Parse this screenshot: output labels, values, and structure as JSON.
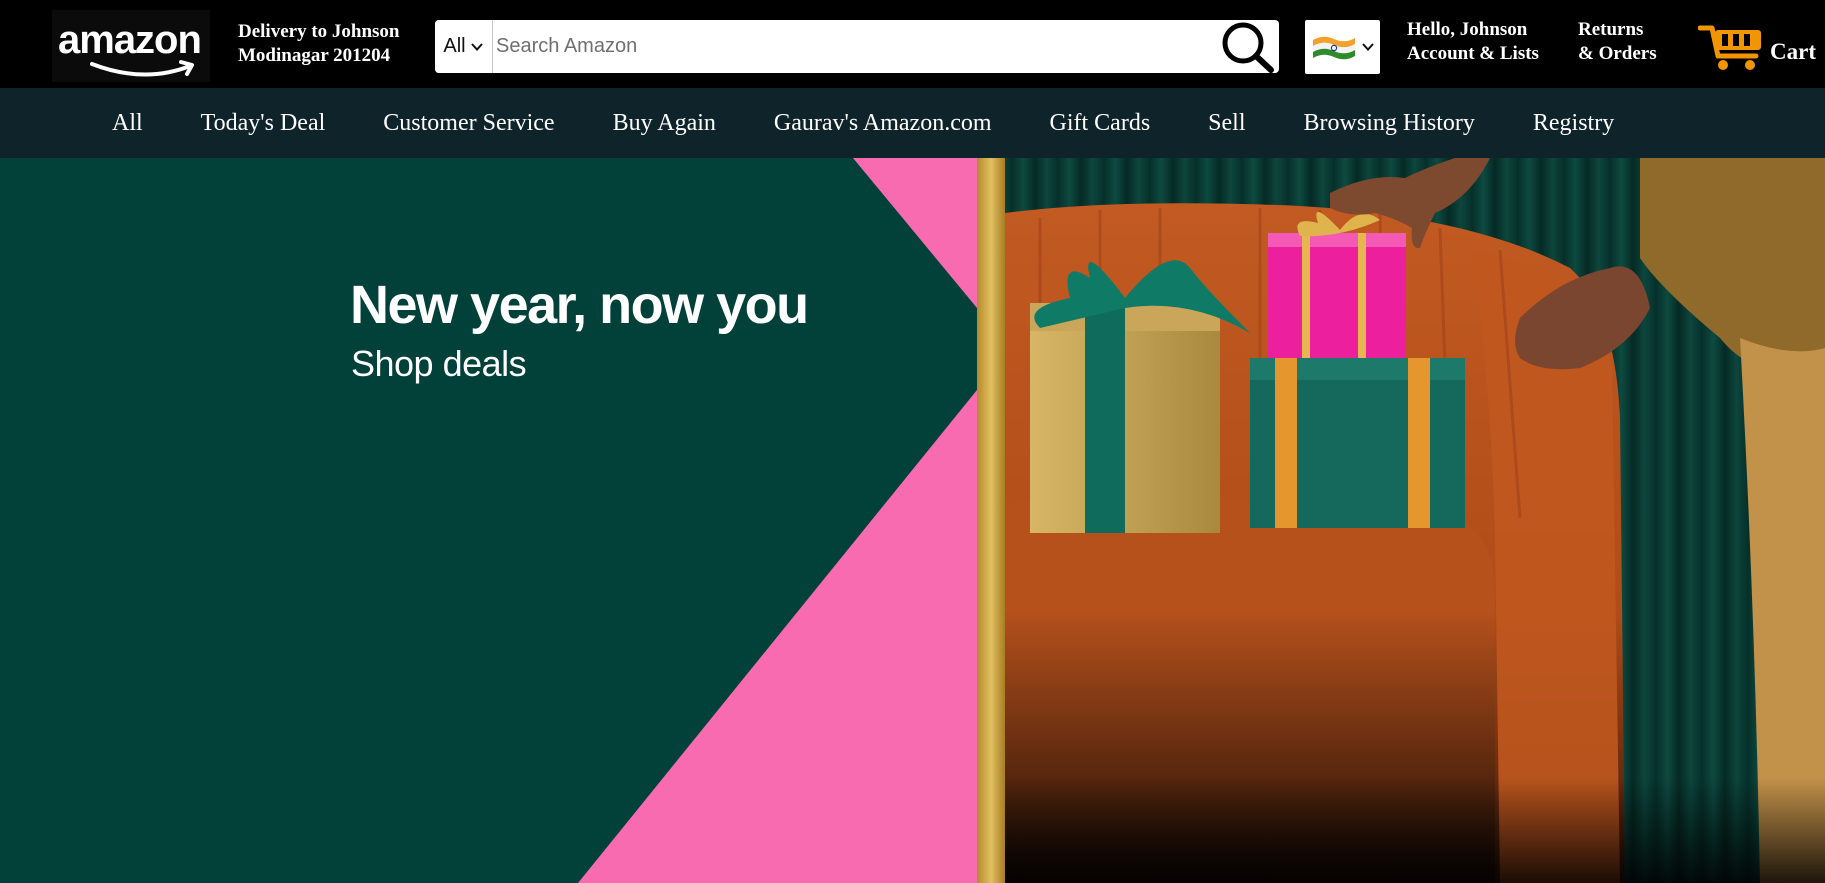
{
  "header": {
    "logo_text": "amazon",
    "delivery": {
      "line1": "Delivery to Johnson",
      "line2": "Modinagar 201204"
    },
    "search": {
      "category": "All",
      "placeholder": "Search Amazon"
    },
    "country_flag": "india-flag-icon",
    "account": {
      "line1": "Hello, Johnson",
      "line2": "Account & Lists"
    },
    "orders": {
      "line1": "Returns",
      "line2": "& Orders"
    },
    "cart_label": "Cart"
  },
  "nav": {
    "items": [
      "All",
      "Today's Deal",
      "Customer Service",
      "Buy Again",
      "Gaurav's Amazon.com",
      "Gift Cards",
      "Sell",
      "Browsing History",
      "Registry"
    ]
  },
  "hero": {
    "title": "New year, now you",
    "subtitle": "Shop deals"
  },
  "colors": {
    "topbar": "#000000",
    "navbar": "#0f232b",
    "hero_green": "#01413a",
    "hero_pink": "#f96bb0",
    "gold_strip": "#c9a13b",
    "sofa": "#b8501b",
    "curtain": "#0a3a33",
    "cart_orange": "#f19500"
  }
}
